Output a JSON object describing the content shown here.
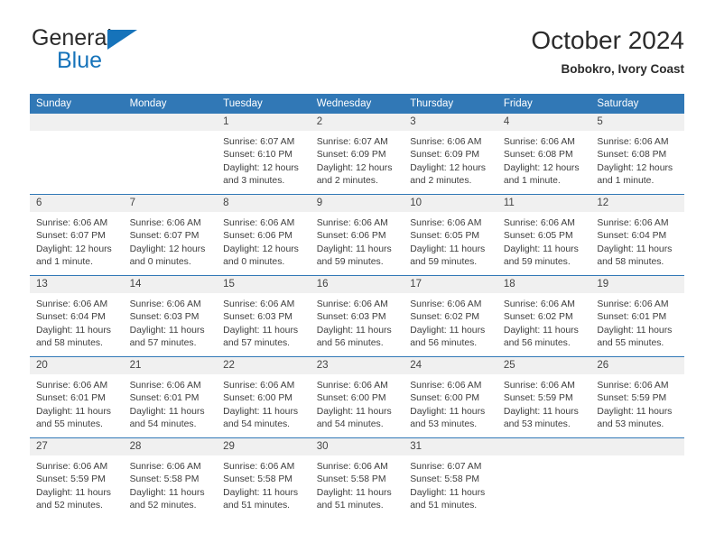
{
  "brand": {
    "name_top": "General",
    "name_bottom": "Blue",
    "triangle_color": "#1673ba"
  },
  "header": {
    "title": "October 2024",
    "subtitle": "Bobokro, Ivory Coast"
  },
  "colors": {
    "header_blue": "#3178b6",
    "daynum_band": "#f0f0f0",
    "text": "#3d3d3d"
  },
  "calendar": {
    "weekday_headers": [
      "Sunday",
      "Monday",
      "Tuesday",
      "Wednesday",
      "Thursday",
      "Friday",
      "Saturday"
    ],
    "labels": {
      "sunrise": "Sunrise:",
      "sunset": "Sunset:",
      "daylight": "Daylight:"
    },
    "weeks": [
      [
        {
          "day": "",
          "blank": true
        },
        {
          "day": "",
          "blank": true
        },
        {
          "day": "1",
          "sunrise": "Sunrise: 6:07 AM",
          "sunset": "Sunset: 6:10 PM",
          "daylight_1": "Daylight: 12 hours",
          "daylight_2": "and 3 minutes."
        },
        {
          "day": "2",
          "sunrise": "Sunrise: 6:07 AM",
          "sunset": "Sunset: 6:09 PM",
          "daylight_1": "Daylight: 12 hours",
          "daylight_2": "and 2 minutes."
        },
        {
          "day": "3",
          "sunrise": "Sunrise: 6:06 AM",
          "sunset": "Sunset: 6:09 PM",
          "daylight_1": "Daylight: 12 hours",
          "daylight_2": "and 2 minutes."
        },
        {
          "day": "4",
          "sunrise": "Sunrise: 6:06 AM",
          "sunset": "Sunset: 6:08 PM",
          "daylight_1": "Daylight: 12 hours",
          "daylight_2": "and 1 minute."
        },
        {
          "day": "5",
          "sunrise": "Sunrise: 6:06 AM",
          "sunset": "Sunset: 6:08 PM",
          "daylight_1": "Daylight: 12 hours",
          "daylight_2": "and 1 minute."
        }
      ],
      [
        {
          "day": "6",
          "sunrise": "Sunrise: 6:06 AM",
          "sunset": "Sunset: 6:07 PM",
          "daylight_1": "Daylight: 12 hours",
          "daylight_2": "and 1 minute."
        },
        {
          "day": "7",
          "sunrise": "Sunrise: 6:06 AM",
          "sunset": "Sunset: 6:07 PM",
          "daylight_1": "Daylight: 12 hours",
          "daylight_2": "and 0 minutes."
        },
        {
          "day": "8",
          "sunrise": "Sunrise: 6:06 AM",
          "sunset": "Sunset: 6:06 PM",
          "daylight_1": "Daylight: 12 hours",
          "daylight_2": "and 0 minutes."
        },
        {
          "day": "9",
          "sunrise": "Sunrise: 6:06 AM",
          "sunset": "Sunset: 6:06 PM",
          "daylight_1": "Daylight: 11 hours",
          "daylight_2": "and 59 minutes."
        },
        {
          "day": "10",
          "sunrise": "Sunrise: 6:06 AM",
          "sunset": "Sunset: 6:05 PM",
          "daylight_1": "Daylight: 11 hours",
          "daylight_2": "and 59 minutes."
        },
        {
          "day": "11",
          "sunrise": "Sunrise: 6:06 AM",
          "sunset": "Sunset: 6:05 PM",
          "daylight_1": "Daylight: 11 hours",
          "daylight_2": "and 59 minutes."
        },
        {
          "day": "12",
          "sunrise": "Sunrise: 6:06 AM",
          "sunset": "Sunset: 6:04 PM",
          "daylight_1": "Daylight: 11 hours",
          "daylight_2": "and 58 minutes."
        }
      ],
      [
        {
          "day": "13",
          "sunrise": "Sunrise: 6:06 AM",
          "sunset": "Sunset: 6:04 PM",
          "daylight_1": "Daylight: 11 hours",
          "daylight_2": "and 58 minutes."
        },
        {
          "day": "14",
          "sunrise": "Sunrise: 6:06 AM",
          "sunset": "Sunset: 6:03 PM",
          "daylight_1": "Daylight: 11 hours",
          "daylight_2": "and 57 minutes."
        },
        {
          "day": "15",
          "sunrise": "Sunrise: 6:06 AM",
          "sunset": "Sunset: 6:03 PM",
          "daylight_1": "Daylight: 11 hours",
          "daylight_2": "and 57 minutes."
        },
        {
          "day": "16",
          "sunrise": "Sunrise: 6:06 AM",
          "sunset": "Sunset: 6:03 PM",
          "daylight_1": "Daylight: 11 hours",
          "daylight_2": "and 56 minutes."
        },
        {
          "day": "17",
          "sunrise": "Sunrise: 6:06 AM",
          "sunset": "Sunset: 6:02 PM",
          "daylight_1": "Daylight: 11 hours",
          "daylight_2": "and 56 minutes."
        },
        {
          "day": "18",
          "sunrise": "Sunrise: 6:06 AM",
          "sunset": "Sunset: 6:02 PM",
          "daylight_1": "Daylight: 11 hours",
          "daylight_2": "and 56 minutes."
        },
        {
          "day": "19",
          "sunrise": "Sunrise: 6:06 AM",
          "sunset": "Sunset: 6:01 PM",
          "daylight_1": "Daylight: 11 hours",
          "daylight_2": "and 55 minutes."
        }
      ],
      [
        {
          "day": "20",
          "sunrise": "Sunrise: 6:06 AM",
          "sunset": "Sunset: 6:01 PM",
          "daylight_1": "Daylight: 11 hours",
          "daylight_2": "and 55 minutes."
        },
        {
          "day": "21",
          "sunrise": "Sunrise: 6:06 AM",
          "sunset": "Sunset: 6:01 PM",
          "daylight_1": "Daylight: 11 hours",
          "daylight_2": "and 54 minutes."
        },
        {
          "day": "22",
          "sunrise": "Sunrise: 6:06 AM",
          "sunset": "Sunset: 6:00 PM",
          "daylight_1": "Daylight: 11 hours",
          "daylight_2": "and 54 minutes."
        },
        {
          "day": "23",
          "sunrise": "Sunrise: 6:06 AM",
          "sunset": "Sunset: 6:00 PM",
          "daylight_1": "Daylight: 11 hours",
          "daylight_2": "and 54 minutes."
        },
        {
          "day": "24",
          "sunrise": "Sunrise: 6:06 AM",
          "sunset": "Sunset: 6:00 PM",
          "daylight_1": "Daylight: 11 hours",
          "daylight_2": "and 53 minutes."
        },
        {
          "day": "25",
          "sunrise": "Sunrise: 6:06 AM",
          "sunset": "Sunset: 5:59 PM",
          "daylight_1": "Daylight: 11 hours",
          "daylight_2": "and 53 minutes."
        },
        {
          "day": "26",
          "sunrise": "Sunrise: 6:06 AM",
          "sunset": "Sunset: 5:59 PM",
          "daylight_1": "Daylight: 11 hours",
          "daylight_2": "and 53 minutes."
        }
      ],
      [
        {
          "day": "27",
          "sunrise": "Sunrise: 6:06 AM",
          "sunset": "Sunset: 5:59 PM",
          "daylight_1": "Daylight: 11 hours",
          "daylight_2": "and 52 minutes."
        },
        {
          "day": "28",
          "sunrise": "Sunrise: 6:06 AM",
          "sunset": "Sunset: 5:58 PM",
          "daylight_1": "Daylight: 11 hours",
          "daylight_2": "and 52 minutes."
        },
        {
          "day": "29",
          "sunrise": "Sunrise: 6:06 AM",
          "sunset": "Sunset: 5:58 PM",
          "daylight_1": "Daylight: 11 hours",
          "daylight_2": "and 51 minutes."
        },
        {
          "day": "30",
          "sunrise": "Sunrise: 6:06 AM",
          "sunset": "Sunset: 5:58 PM",
          "daylight_1": "Daylight: 11 hours",
          "daylight_2": "and 51 minutes."
        },
        {
          "day": "31",
          "sunrise": "Sunrise: 6:07 AM",
          "sunset": "Sunset: 5:58 PM",
          "daylight_1": "Daylight: 11 hours",
          "daylight_2": "and 51 minutes."
        },
        {
          "day": "",
          "blank": true
        },
        {
          "day": "",
          "blank": true
        }
      ]
    ]
  }
}
